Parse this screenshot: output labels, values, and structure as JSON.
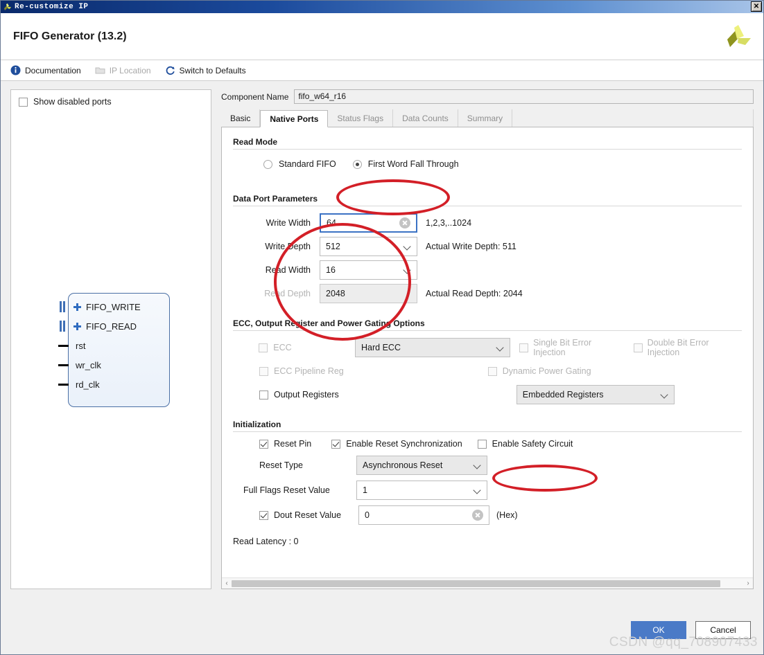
{
  "window": {
    "title": "Re-customize IP",
    "close_label": "✕",
    "app_icon": "xilinx-logo-icon"
  },
  "header": {
    "title": "FIFO Generator (13.2)",
    "logo": "xilinx-pinwheel-logo"
  },
  "toolbar": {
    "items": [
      {
        "label": "Documentation",
        "icon": "info-icon",
        "disabled": false
      },
      {
        "label": "IP Location",
        "icon": "folder-icon",
        "disabled": true
      },
      {
        "label": "Switch to Defaults",
        "icon": "refresh-icon",
        "disabled": false
      }
    ]
  },
  "left_panel": {
    "show_disabled_ports": {
      "label": "Show disabled ports",
      "checked": false
    },
    "diagram": {
      "ports": [
        {
          "name": "FIFO_WRITE",
          "type": "bus",
          "expandable": true
        },
        {
          "name": "FIFO_READ",
          "type": "bus",
          "expandable": true
        },
        {
          "name": "rst",
          "type": "pin",
          "expandable": false
        },
        {
          "name": "wr_clk",
          "type": "pin",
          "expandable": false
        },
        {
          "name": "rd_clk",
          "type": "pin",
          "expandable": false
        }
      ]
    }
  },
  "component": {
    "label": "Component Name",
    "value": "fifo_w64_r16"
  },
  "tabs": [
    {
      "label": "Basic",
      "state": "enabled"
    },
    {
      "label": "Native Ports",
      "state": "active"
    },
    {
      "label": "Status Flags",
      "state": "inactive"
    },
    {
      "label": "Data Counts",
      "state": "inactive"
    },
    {
      "label": "Summary",
      "state": "inactive"
    }
  ],
  "read_mode": {
    "section_title": "Read Mode",
    "options": [
      {
        "label": "Standard FIFO",
        "selected": false
      },
      {
        "label": "First Word Fall Through",
        "selected": true
      }
    ]
  },
  "data_port": {
    "section_title": "Data Port Parameters",
    "write_width": {
      "label": "Write Width",
      "value": "64",
      "hint": "1,2,3,..1024",
      "focused": true
    },
    "write_depth": {
      "label": "Write Depth",
      "value": "512",
      "hint": "Actual Write Depth: 511"
    },
    "read_width": {
      "label": "Read Width",
      "value": "16",
      "hint": ""
    },
    "read_depth": {
      "label": "Read Depth",
      "value": "2048",
      "hint": "Actual Read Depth: 2044",
      "disabled": true
    }
  },
  "ecc": {
    "section_title": "ECC, Output Register and Power Gating Options",
    "ecc_checkbox": {
      "label": "ECC",
      "checked": false,
      "disabled": true
    },
    "ecc_select": {
      "value": "Hard ECC",
      "disabled": true
    },
    "single_bit": {
      "label": "Single Bit Error Injection",
      "checked": false,
      "disabled": true
    },
    "double_bit": {
      "label": "Double Bit Error Injection",
      "checked": false,
      "disabled": true
    },
    "ecc_pipeline": {
      "label": "ECC Pipeline Reg",
      "checked": false,
      "disabled": true
    },
    "dynamic_power_gating": {
      "label": "Dynamic Power Gating",
      "checked": false,
      "disabled": true
    },
    "output_registers": {
      "label": "Output Registers",
      "checked": false,
      "disabled": false
    },
    "registers_select": {
      "value": "Embedded Registers",
      "disabled": true
    }
  },
  "initialization": {
    "section_title": "Initialization",
    "reset_pin": {
      "label": "Reset Pin",
      "checked": true
    },
    "enable_reset_sync": {
      "label": "Enable Reset Synchronization",
      "checked": true
    },
    "enable_safety_circuit": {
      "label": "Enable Safety Circuit",
      "checked": false
    },
    "reset_type": {
      "label": "Reset Type",
      "value": "Asynchronous Reset"
    },
    "full_flags_reset_value": {
      "label": "Full Flags Reset Value",
      "value": "1"
    },
    "dout_reset_value": {
      "label": "Dout Reset Value",
      "checked": true,
      "value": "0",
      "suffix": "(Hex)"
    },
    "read_latency": "Read Latency : 0"
  },
  "scrollbar": {
    "left_arrow": "‹",
    "right_arrow": "›"
  },
  "footer": {
    "ok_label": "OK",
    "cancel_label": "Cancel",
    "watermark": "CSDN @qq_708907433"
  },
  "colors": {
    "titlebar_start": "#0a2a6b",
    "accent_blue": "#4a7ac7",
    "annotation_red": "#d31f27",
    "block_border": "#4a6fa5"
  }
}
